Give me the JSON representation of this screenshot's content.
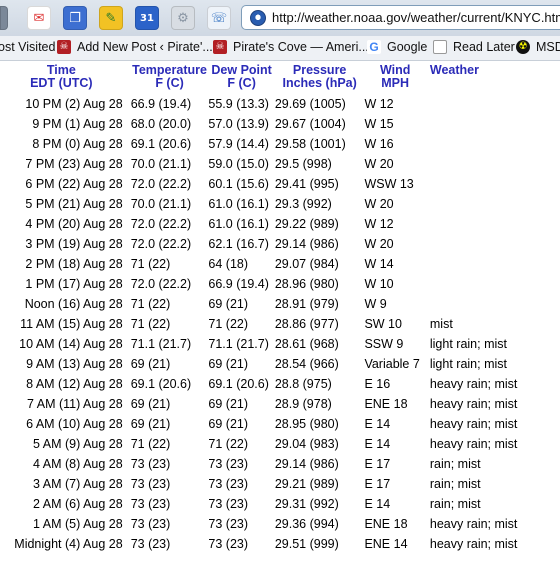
{
  "toolbar": {
    "buttons": [
      "gmail-icon",
      "tabs-icon",
      "bookmark-icon",
      "calendar-icon",
      "gear-icon",
      "phone-icon"
    ],
    "calendar_label": "31",
    "url": "http://weather.noaa.gov/weather/current/KNYC.html"
  },
  "bookmarks": {
    "items": [
      {
        "label": "ost Visited",
        "icon": ""
      },
      {
        "label": "Add New Post ‹ Pirate'...",
        "icon": "pirate-icon"
      },
      {
        "label": "Pirate's Cove — Ameri...",
        "icon": "pirate-icon"
      },
      {
        "label": "Google",
        "icon": "google-icon"
      },
      {
        "label": "Read Later",
        "icon": "page-icon"
      },
      {
        "label": "MSD",
        "icon": "radiation-icon"
      }
    ]
  },
  "table": {
    "headers": {
      "time": [
        "Time",
        "EDT (UTC)"
      ],
      "temp": [
        "Temperature",
        "F (C)"
      ],
      "dew": [
        "Dew Point",
        "F (C)"
      ],
      "pres": [
        "Pressure",
        "Inches (hPa)"
      ],
      "wind": [
        "Wind",
        "MPH"
      ],
      "weather": [
        "Weather"
      ]
    },
    "rows": [
      [
        "10 PM (2) Aug 28",
        "66.9 (19.4)",
        "55.9 (13.3)",
        "29.69 (1005)",
        "W 12",
        ""
      ],
      [
        "9 PM (1) Aug 28",
        "68.0 (20.0)",
        "57.0 (13.9)",
        "29.67 (1004)",
        "W 15",
        ""
      ],
      [
        "8 PM (0) Aug 28",
        "69.1 (20.6)",
        "57.9 (14.4)",
        "29.58 (1001)",
        "W 16",
        ""
      ],
      [
        "7 PM (23) Aug 28",
        "70.0 (21.1)",
        "59.0 (15.0)",
        "29.5 (998)",
        "W 20",
        ""
      ],
      [
        "6 PM (22) Aug 28",
        "72.0 (22.2)",
        "60.1 (15.6)",
        "29.41 (995)",
        "WSW 13",
        ""
      ],
      [
        "5 PM (21) Aug 28",
        "70.0 (21.1)",
        "61.0 (16.1)",
        "29.3 (992)",
        "W 20",
        ""
      ],
      [
        "4 PM (20) Aug 28",
        "72.0 (22.2)",
        "61.0 (16.1)",
        "29.22 (989)",
        "W 12",
        ""
      ],
      [
        "3 PM (19) Aug 28",
        "72.0 (22.2)",
        "62.1 (16.7)",
        "29.14 (986)",
        "W 20",
        ""
      ],
      [
        "2 PM (18) Aug 28",
        "71 (22)",
        "64 (18)",
        "29.07 (984)",
        "W 14",
        ""
      ],
      [
        "1 PM (17) Aug 28",
        "72.0 (22.2)",
        "66.9 (19.4)",
        "28.96 (980)",
        "W 10",
        ""
      ],
      [
        "Noon (16) Aug 28",
        "71 (22)",
        "69 (21)",
        "28.91 (979)",
        "W 9",
        ""
      ],
      [
        "11 AM (15) Aug 28",
        "71 (22)",
        "71 (22)",
        "28.86 (977)",
        "SW 10",
        "mist"
      ],
      [
        "10 AM (14) Aug 28",
        "71.1 (21.7)",
        "71.1 (21.7)",
        "28.61 (968)",
        "SSW 9",
        "light rain; mist"
      ],
      [
        "9 AM (13) Aug 28",
        "69 (21)",
        "69 (21)",
        "28.54 (966)",
        "Variable 7",
        "light rain; mist"
      ],
      [
        "8 AM (12) Aug 28",
        "69.1 (20.6)",
        "69.1 (20.6)",
        "28.8 (975)",
        "E 16",
        "heavy rain; mist"
      ],
      [
        "7 AM (11) Aug 28",
        "69 (21)",
        "69 (21)",
        "28.9 (978)",
        "ENE 18",
        "heavy rain; mist"
      ],
      [
        "6 AM (10) Aug 28",
        "69 (21)",
        "69 (21)",
        "28.95 (980)",
        "E 14",
        "heavy rain; mist"
      ],
      [
        "5 AM (9) Aug 28",
        "71 (22)",
        "71 (22)",
        "29.04 (983)",
        "E 14",
        "heavy rain; mist"
      ],
      [
        "4 AM (8) Aug 28",
        "73 (23)",
        "73 (23)",
        "29.14 (986)",
        "E 17",
        "rain; mist"
      ],
      [
        "3 AM (7) Aug 28",
        "73 (23)",
        "73 (23)",
        "29.21 (989)",
        "E 17",
        "rain; mist"
      ],
      [
        "2 AM (6) Aug 28",
        "73 (23)",
        "73 (23)",
        "29.31 (992)",
        "E 14",
        "rain; mist"
      ],
      [
        "1 AM (5) Aug 28",
        "73 (23)",
        "73 (23)",
        "29.36 (994)",
        "ENE 18",
        "heavy rain; mist"
      ],
      [
        "Midnight (4) Aug 28",
        "73 (23)",
        "73 (23)",
        "29.51 (999)",
        "ENE 14",
        "heavy rain; mist"
      ]
    ]
  },
  "colors": {
    "header_text": "#2b2bb8",
    "toolbar_bg": "#d6dee8"
  }
}
